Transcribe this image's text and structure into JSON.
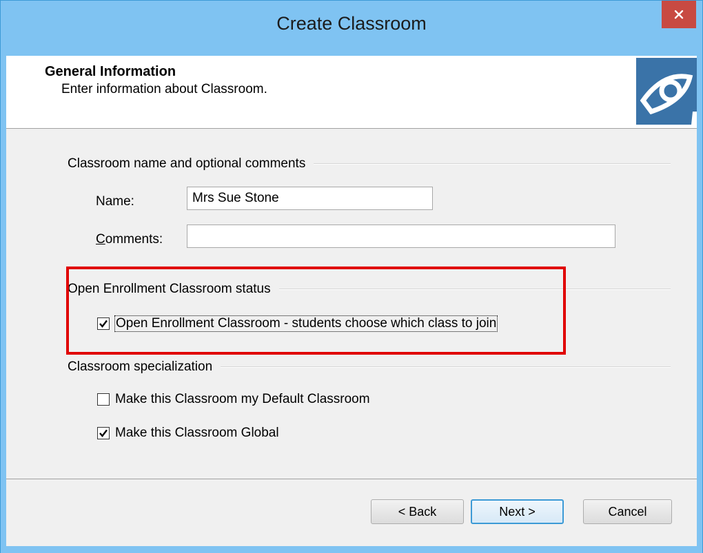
{
  "window": {
    "title": "Create Classroom",
    "close_icon": "close-icon"
  },
  "header": {
    "title": "General Information",
    "subtitle": "Enter information about Classroom.",
    "logo_icon": "classroom-logo-icon"
  },
  "groups": {
    "name_comments": {
      "title": "Classroom name and optional comments",
      "name_label": "Name:",
      "name_value": "Mrs Sue Stone",
      "comments_label_underlined": "C",
      "comments_label_rest": "omments:",
      "comments_value": ""
    },
    "open_enrollment": {
      "title": "Open Enrollment Classroom status",
      "checkbox_label": "Open Enrollment Classroom - students choose which class to join",
      "checked": true
    },
    "specialization": {
      "title": "Classroom specialization",
      "default_label": "Make this Classroom my Default Classroom",
      "default_checked": false,
      "global_label": "Make this Classroom Global",
      "global_checked": true
    }
  },
  "buttons": {
    "back": "< Back",
    "next": "Next >",
    "cancel": "Cancel"
  },
  "colors": {
    "title_bar": "#7fc3f2",
    "close_button": "#c84a42",
    "highlight": "#e00000",
    "default_button_border": "#3c9ad6"
  }
}
